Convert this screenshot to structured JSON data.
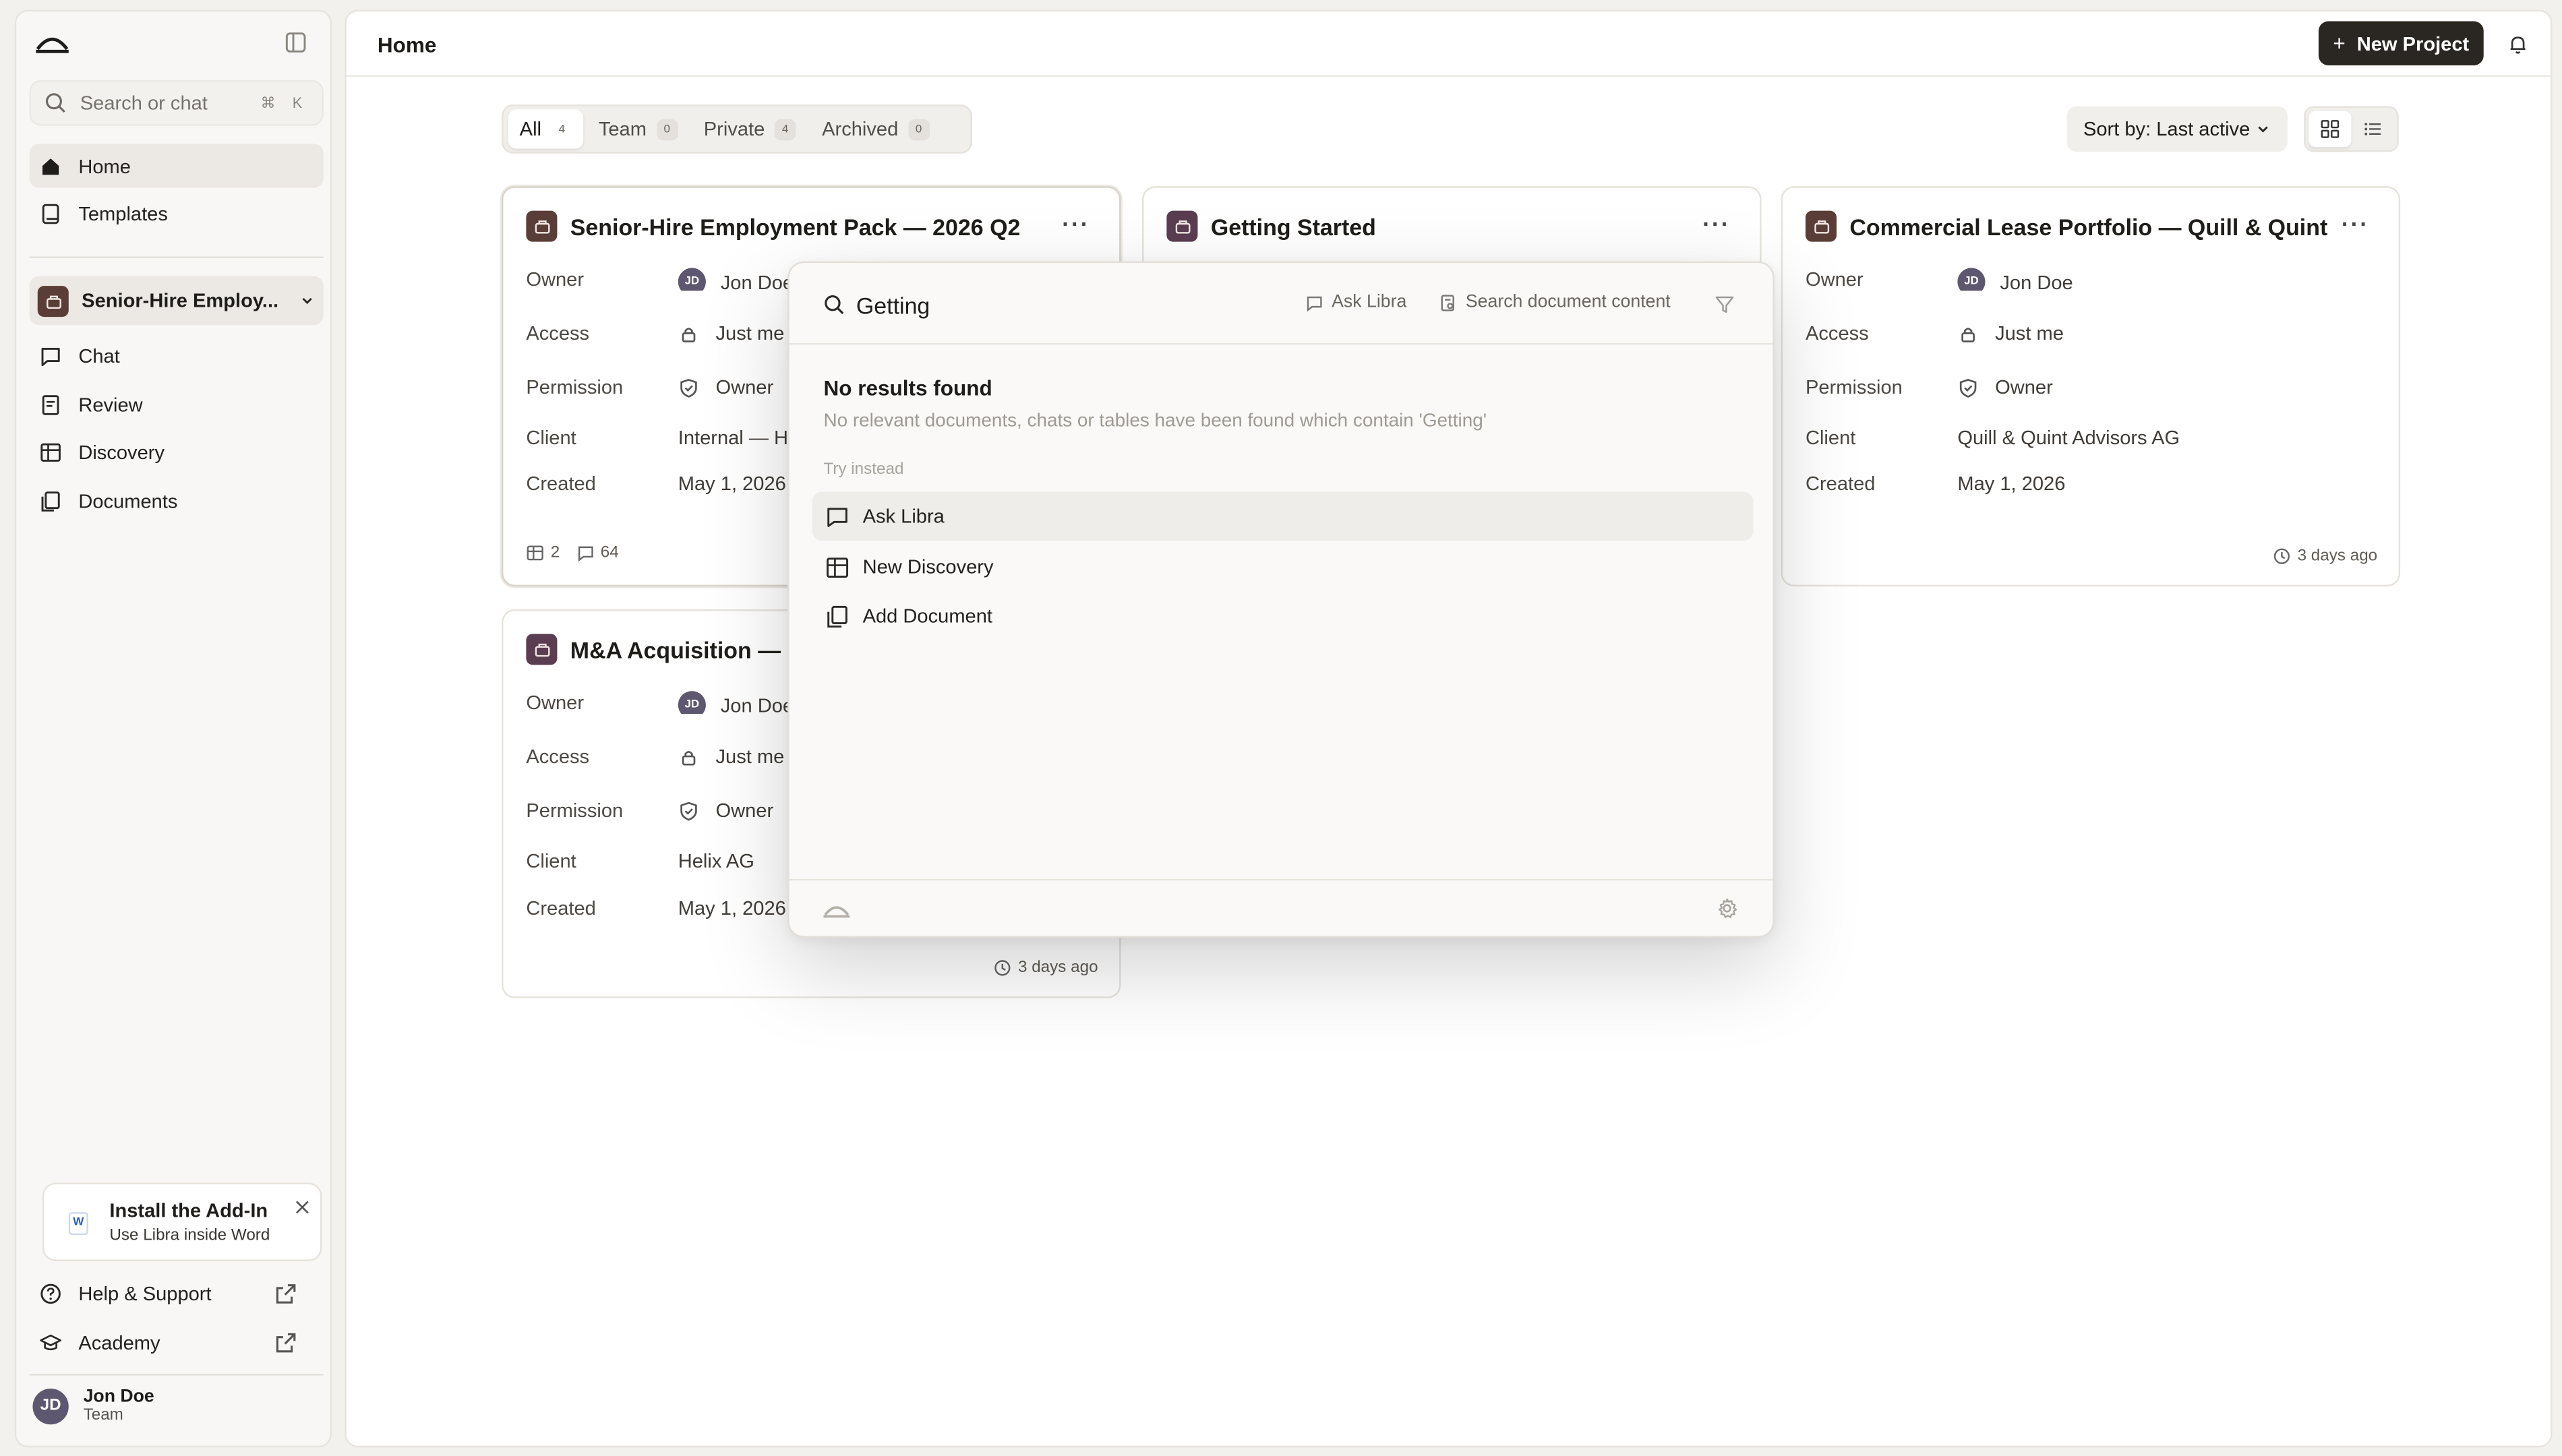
{
  "app": {
    "name": "Libra"
  },
  "sidebar": {
    "search_placeholder": "Search or chat",
    "search_shortcut": "⌘ K",
    "nav": [
      {
        "label": "Home",
        "icon": "home-icon",
        "active": true
      },
      {
        "label": "Templates",
        "icon": "book-icon",
        "active": false
      }
    ],
    "project": {
      "label": "Senior-Hire Employ...",
      "color": "#5a3d36"
    },
    "project_nav": [
      {
        "label": "Chat",
        "icon": "chat-icon"
      },
      {
        "label": "Review",
        "icon": "review-icon"
      },
      {
        "label": "Discovery",
        "icon": "table-icon"
      },
      {
        "label": "Documents",
        "icon": "documents-icon"
      }
    ],
    "addin": {
      "title": "Install the Add-In",
      "subtitle": "Use Libra inside Word",
      "badge": "W"
    },
    "bottom_nav": [
      {
        "label": "Help & Support",
        "icon": "help-icon"
      },
      {
        "label": "Academy",
        "icon": "academy-icon"
      }
    ],
    "user": {
      "initials": "JD",
      "name": "Jon Doe",
      "role": "Team"
    }
  },
  "header": {
    "breadcrumb": "Home",
    "new_project_label": "New Project"
  },
  "filters": {
    "tabs": [
      {
        "label": "All",
        "count": "4",
        "active": true
      },
      {
        "label": "Team",
        "count": "0",
        "active": false
      },
      {
        "label": "Private",
        "count": "4",
        "active": false
      },
      {
        "label": "Archived",
        "count": "0",
        "active": false
      }
    ],
    "sort_label": "Sort by: Last active"
  },
  "field_labels": {
    "owner": "Owner",
    "access": "Access",
    "permission": "Permission",
    "client": "Client",
    "created": "Created"
  },
  "projects": [
    {
      "title": "Senior-Hire Employment Pack — 2026 Q2",
      "color": "#5a3d36",
      "owner": "Jon Doe",
      "owner_initials": "JD",
      "access": "Just me",
      "permission": "Owner",
      "client": "Internal — HR",
      "created": "May 1, 2026",
      "tables": "2",
      "chats": "64"
    },
    {
      "title": "Getting Started",
      "color": "#5b3d52"
    },
    {
      "title": "Commercial Lease Portfolio — Quill & Quint",
      "color": "#5a3d36",
      "owner": "Jon Doe",
      "owner_initials": "JD",
      "access": "Just me",
      "permission": "Owner",
      "client": "Quill & Quint Advisors AG",
      "created": "May 1, 2026",
      "last_active": "3 days ago"
    },
    {
      "title": "M&A Acquisition — Pr",
      "color": "#5b3d52",
      "owner": "Jon Doe",
      "owner_initials": "JD",
      "access": "Just me",
      "permission": "Owner",
      "client": "Helix AG",
      "created": "May 1, 2026",
      "last_active": "3 days ago"
    }
  ],
  "palette": {
    "query": "Getting",
    "ask_label": "Ask Libra",
    "search_content_label": "Search document content",
    "no_results_title": "No results found",
    "no_results_text": "No relevant documents, chats or tables have been found which contain 'Getting'",
    "try_instead": "Try instead",
    "options": [
      {
        "label": "Ask Libra",
        "icon": "chat-icon",
        "highlighted": true
      },
      {
        "label": "New Discovery",
        "icon": "table-icon",
        "highlighted": false
      },
      {
        "label": "Add Document",
        "icon": "documents-icon",
        "highlighted": false
      }
    ]
  }
}
